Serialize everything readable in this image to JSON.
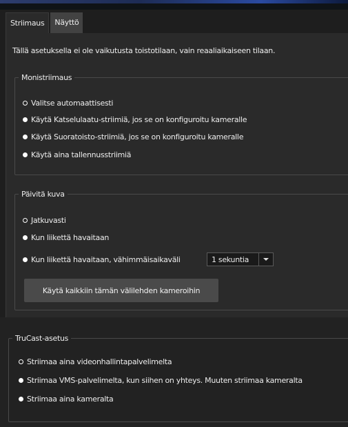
{
  "tabs": [
    {
      "label": "Striimaus",
      "active": true
    },
    {
      "label": "Näyttö",
      "active": false
    }
  ],
  "note": "Tällä asetuksella ei ole vaikutusta toistotilaan, vain reaaliaikaiseen tilaan.",
  "multistream": {
    "legend": "Monistriimaus",
    "options": [
      {
        "label": "Valitse automaattisesti",
        "selected": true
      },
      {
        "label": "Käytä Katselulaatu-striimiä, jos se on konfiguroitu kameralle",
        "selected": false
      },
      {
        "label": "Käytä Suoratoisto-striimiä, jos se on konfiguroitu kameralle",
        "selected": false
      },
      {
        "label": "Käytä aina tallennusstriimiä",
        "selected": false
      }
    ]
  },
  "update": {
    "legend": "Päivitä kuva",
    "options": [
      {
        "label": "Jatkuvasti",
        "selected": true
      },
      {
        "label": "Kun liikettä havaitaan",
        "selected": false
      },
      {
        "label": "Kun liikettä havaitaan, vähimmäisaikaväli",
        "selected": false
      }
    ],
    "interval_value": "1 sekuntia",
    "apply_label": "Käytä kaikkiin tämän välilehden kameroihin"
  },
  "trucast": {
    "legend": "TruCast-asetus",
    "options": [
      {
        "label": "Striimaa aina videonhallintapalvelimelta",
        "selected": true
      },
      {
        "label": "Striimaa VMS-palvelimelta, kun siihen on yhteys. Muuten striimaa kameralta",
        "selected": false
      },
      {
        "label": "Striimaa aina kameralta",
        "selected": false
      }
    ]
  },
  "colors": {
    "background": "#1e1e1e",
    "panel": "#2a2a2a",
    "button": "#4a4a4a",
    "text": "#ededed"
  }
}
